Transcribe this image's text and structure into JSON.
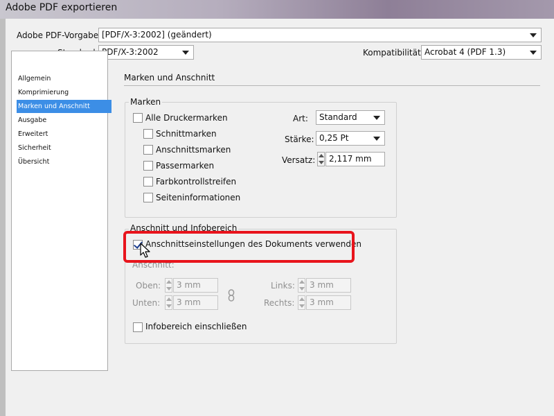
{
  "window": {
    "title": "Adobe PDF exportieren"
  },
  "header": {
    "preset_label": "Adobe PDF-Vorgabe:",
    "preset_value": "[PDF/X-3:2002] (geändert)",
    "standard_label": "Standard:",
    "standard_value": "PDF/X-3:2002",
    "compat_label": "Kompatibilität:",
    "compat_value": "Acrobat 4 (PDF 1.3)"
  },
  "sidebar": {
    "items": [
      {
        "label": "Allgemein"
      },
      {
        "label": "Komprimierung"
      },
      {
        "label": "Marken und Anschnitt"
      },
      {
        "label": "Ausgabe"
      },
      {
        "label": "Erweitert"
      },
      {
        "label": "Sicherheit"
      },
      {
        "label": "Übersicht"
      }
    ],
    "selected_index": 2
  },
  "main": {
    "section_title": "Marken und Anschnitt",
    "marks": {
      "group_title": "Marken",
      "all_marks": "Alle Druckermarken",
      "options": [
        "Schnittmarken",
        "Anschnittsmarken",
        "Passermarken",
        "Farbkontrollstreifen",
        "Seiteninformationen"
      ],
      "type_label": "Art:",
      "type_value": "Standard",
      "weight_label": "Stärke:",
      "weight_value": "0,25 Pt",
      "offset_label": "Versatz:",
      "offset_value": "2,117 mm"
    },
    "bleed": {
      "group_title": "Anschnitt und Infobereich",
      "use_doc_settings": "Anschnittseinstellungen des Dokuments verwenden",
      "use_doc_checked": true,
      "bleed_label": "Anschnitt:",
      "top_label": "Oben:",
      "top_value": "3 mm",
      "bottom_label": "Unten:",
      "bottom_value": "3 mm",
      "left_label": "Links:",
      "left_value": "3 mm",
      "right_label": "Rechts:",
      "right_value": "3 mm",
      "slug_label": "Infobereich einschließen"
    }
  },
  "colors": {
    "selection": "#3c8ee6",
    "highlight": "#e8141c"
  }
}
